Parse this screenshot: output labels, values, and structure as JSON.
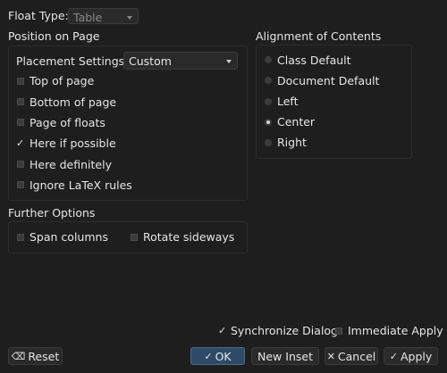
{
  "float_type": {
    "label": "Float Type:",
    "value": "Table"
  },
  "position": {
    "title": "Position on Page",
    "placement_label": "Placement Settings:",
    "placement_value": "Custom",
    "options": [
      {
        "label": "Top of page",
        "checked": false
      },
      {
        "label": "Bottom of page",
        "checked": false
      },
      {
        "label": "Page of floats",
        "checked": false
      },
      {
        "label": "Here if possible",
        "checked": true
      },
      {
        "label": "Here definitely",
        "checked": false
      },
      {
        "label": "Ignore LaTeX rules",
        "checked": false
      }
    ]
  },
  "alignment": {
    "title": "Alignment of Contents",
    "options": [
      {
        "label": "Class Default",
        "selected": false
      },
      {
        "label": "Document Default",
        "selected": false
      },
      {
        "label": "Left",
        "selected": false
      },
      {
        "label": "Center",
        "selected": true
      },
      {
        "label": "Right",
        "selected": false
      }
    ]
  },
  "further": {
    "title": "Further Options",
    "span_columns": "Span columns",
    "rotate_sideways": "Rotate sideways"
  },
  "footer": {
    "synchronize": "Synchronize Dialog",
    "immediate": "Immediate Apply"
  },
  "buttons": {
    "reset": "Reset",
    "ok": "OK",
    "new_inset": "New Inset",
    "cancel": "Cancel",
    "apply": "Apply"
  },
  "icons": {
    "check": "✓",
    "cross": "✕",
    "reset": "⌫"
  }
}
